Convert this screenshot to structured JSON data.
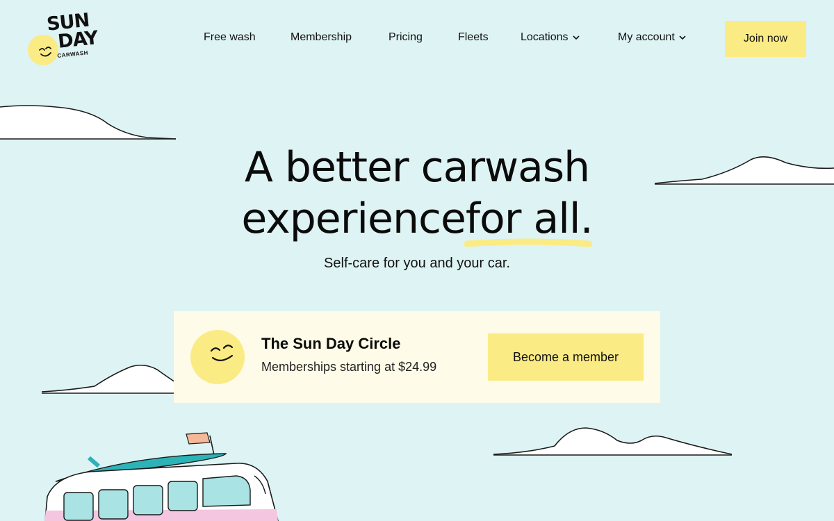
{
  "logo": {
    "line1": "SUN",
    "line2": "DAY",
    "line3": "CARWASH",
    "icon": "smiling-sun-icon",
    "color": "#fbeb84"
  },
  "nav": {
    "items": [
      {
        "label": "Free wash",
        "has_dropdown": false
      },
      {
        "label": "Membership",
        "has_dropdown": false
      },
      {
        "label": "Pricing",
        "has_dropdown": false
      },
      {
        "label": "Fleets",
        "has_dropdown": false
      },
      {
        "label": "Locations",
        "has_dropdown": true
      },
      {
        "label": "My account",
        "has_dropdown": true
      }
    ],
    "cta_label": "Join now"
  },
  "hero": {
    "title_line1": "A better carwash",
    "title_line2_a": "experience",
    "title_line2_b": "for all.",
    "subtitle": "Self-care for you and your car."
  },
  "membership_card": {
    "title": "The Sun Day Circle",
    "subtitle": "Memberships starting at $24.99",
    "button_label": "Become a member",
    "icon": "smiling-sun-icon"
  },
  "colors": {
    "background": "#def3f3",
    "accent_yellow": "#fbeb84",
    "card_background": "#fefbe8",
    "text": "#111111"
  }
}
